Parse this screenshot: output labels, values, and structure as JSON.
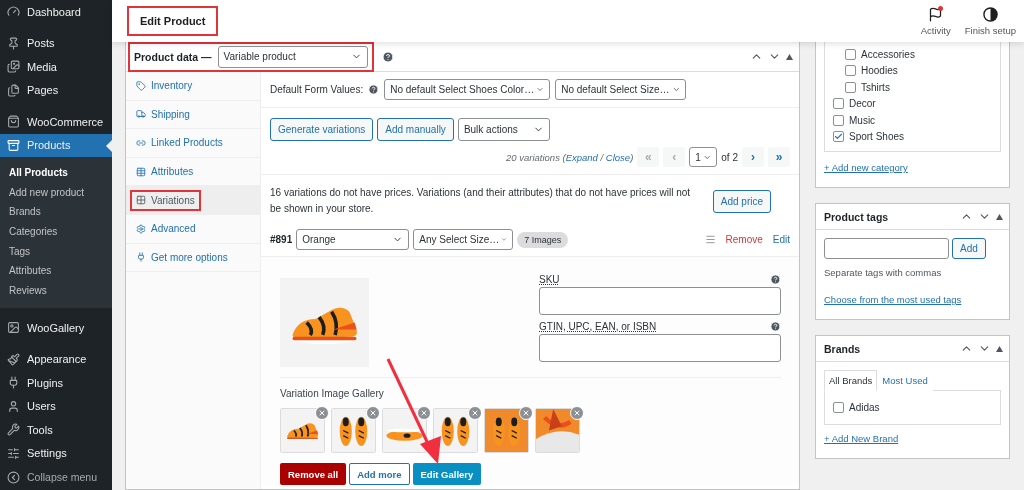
{
  "sidebar": {
    "items": [
      {
        "label": "Dashboard",
        "selected": false
      },
      {
        "label": "Posts",
        "selected": false
      },
      {
        "label": "Media",
        "selected": false
      },
      {
        "label": "Pages",
        "selected": false
      },
      {
        "label": "WooCommerce",
        "selected": false
      },
      {
        "label": "Products",
        "selected": true,
        "children": [
          {
            "label": "All Products",
            "selected": true
          },
          {
            "label": "Add new product",
            "selected": false
          },
          {
            "label": "Brands",
            "selected": false
          },
          {
            "label": "Categories",
            "selected": false
          },
          {
            "label": "Tags",
            "selected": false
          },
          {
            "label": "Attributes",
            "selected": false
          },
          {
            "label": "Reviews",
            "selected": false
          }
        ]
      },
      {
        "label": "WooGallery",
        "selected": false
      },
      {
        "label": "Appearance",
        "selected": false
      },
      {
        "label": "Plugins",
        "selected": false
      },
      {
        "label": "Users",
        "selected": false
      },
      {
        "label": "Tools",
        "selected": false
      },
      {
        "label": "Settings",
        "selected": false
      }
    ],
    "collapse_label": "Collapse menu"
  },
  "header": {
    "title": "Edit Product",
    "highlighted": true,
    "actions": [
      {
        "label": "Activity",
        "notification": true
      },
      {
        "label": "Finish setup"
      }
    ]
  },
  "product_data": {
    "label": "Product data —",
    "type": "Variable product",
    "highlighted": true,
    "tabs": [
      {
        "label": "Inventory",
        "selected": false,
        "highlighted": false
      },
      {
        "label": "Shipping",
        "selected": false,
        "highlighted": false
      },
      {
        "label": "Linked Products",
        "selected": false,
        "highlighted": false
      },
      {
        "label": "Attributes",
        "selected": false,
        "highlighted": false
      },
      {
        "label": "Variations",
        "selected": true,
        "highlighted": true
      },
      {
        "label": "Advanced",
        "selected": false,
        "highlighted": false
      },
      {
        "label": "Get more options",
        "selected": false,
        "highlighted": false
      }
    ],
    "default_form": {
      "label": "Default Form Values:",
      "selects": [
        "No default Select Shoes Color…",
        "No default Select Size…"
      ]
    },
    "toolbar": {
      "buttons": [
        "Generate variations",
        "Add manually"
      ],
      "bulk": "Bulk actions"
    },
    "pagination": {
      "prefix": "20 variations (",
      "expand": "Expand",
      "separator": " / ",
      "close": "Close",
      "suffix": ")",
      "first": "«",
      "prev": "‹",
      "page": "1",
      "of": "of 2",
      "next": "›",
      "last": "»",
      "first_disabled": true,
      "prev_disabled": true
    },
    "notice": {
      "text": "16 variations do not have prices. Variations (and their attributes) that do not have prices will not be shown in your store.",
      "button": "Add price"
    },
    "variation": {
      "id": "#891",
      "options": [
        "Orange",
        "Any Select Size…"
      ],
      "badge": "7 Images",
      "remove": "Remove",
      "edit": "Edit",
      "image": {
        "kind": "picture"
      },
      "fields": [
        {
          "label": "SKU"
        },
        {
          "label": "GTIN, UPC, EAN, or ISBN"
        }
      ],
      "gallery": {
        "label": "Variation Image Gallery",
        "images": [
          {
            "kind": "picture"
          },
          {
            "kind": "picture"
          },
          {
            "kind": "picture"
          },
          {
            "kind": "picture"
          },
          {
            "kind": "picture"
          },
          {
            "kind": "picture"
          }
        ],
        "buttons": [
          {
            "label": "Remove all",
            "kind": "danger"
          },
          {
            "label": "Add more",
            "kind": "secondary"
          },
          {
            "label": "Edit Gallery",
            "kind": "primary"
          }
        ]
      }
    }
  },
  "categories": {
    "child_items": [
      {
        "label": "Accessories",
        "checked": false
      },
      {
        "label": "Hoodies",
        "checked": false
      },
      {
        "label": "Tshirts",
        "checked": false
      }
    ],
    "items": [
      {
        "label": "Decor",
        "checked": false
      },
      {
        "label": "Music",
        "checked": false
      },
      {
        "label": "Sport Shoes",
        "checked": true
      }
    ],
    "add_link": "+ Add new category"
  },
  "product_tags": {
    "title": "Product tags",
    "button": "Add",
    "hint": "Separate tags with commas",
    "link": "Choose from the most used tags"
  },
  "brands": {
    "title": "Brands",
    "tabs": [
      {
        "label": "All Brands",
        "selected": true
      },
      {
        "label": "Most Used",
        "selected": false
      }
    ],
    "items": [
      {
        "label": "Adidas",
        "checked": false
      }
    ],
    "add_link": "+ Add New Brand"
  }
}
